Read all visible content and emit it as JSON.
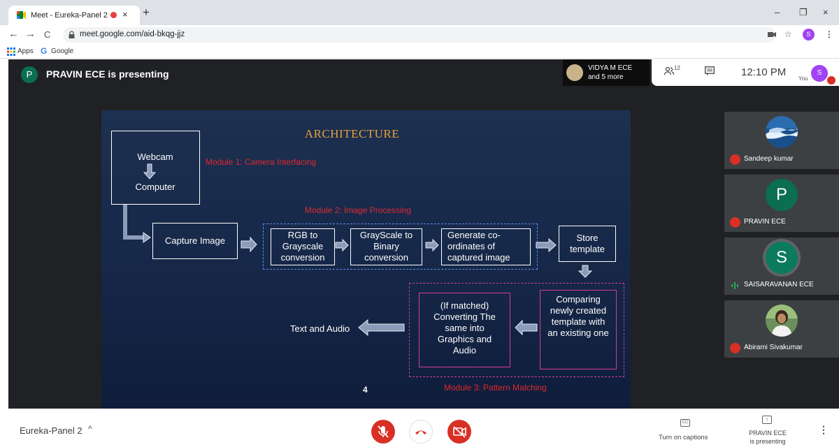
{
  "browser": {
    "tab_title": "Meet - Eureka-Panel 2",
    "tab_close": "×",
    "new_tab": "+",
    "url": "meet.google.com/aid-bkqg-jjz",
    "window_controls": [
      "–",
      "❐",
      "×"
    ],
    "nav": [
      "←",
      "→",
      "C"
    ],
    "bookmarks": [
      {
        "icon": "apps-grid-icon",
        "label": "Apps"
      },
      {
        "icon": "google-g-icon",
        "glyph": "G",
        "label": "Google"
      }
    ],
    "profile_initial": "S"
  },
  "meet": {
    "presenter_initial": "P",
    "presenter_text": "PRAVIN ECE is presenting",
    "viewers": {
      "line1": "VIDYA M ECE",
      "line2": "and 5 more"
    },
    "participants_count": "12",
    "time": "12:10 PM",
    "you_label": "You",
    "you_initial": "S",
    "participants": [
      {
        "name": "Sandeep kumar",
        "muted": true,
        "avatar": "photo-waves"
      },
      {
        "name": "PRAVIN ECE",
        "muted": true,
        "initial": "P",
        "color": "#0b6e4f"
      },
      {
        "name": "SAISARAVANAN ECE",
        "muted": false,
        "speaking": true,
        "initial": "S",
        "color": "#0b7b5e"
      },
      {
        "name": "Abirami Sivakumar",
        "muted": true,
        "avatar": "photo-person"
      }
    ]
  },
  "slide": {
    "title": "ARCHITECTURE",
    "webcam": "Webcam",
    "computer": "Computer",
    "module1": "Module 1: Camera Interfacing",
    "module2": "Module 2: Image Processing",
    "module3": "Module 3: Pattern Matching",
    "capture": "Capture Image",
    "rgb": "RGB to Grayscale conversion",
    "gray": "GrayScale to Binary conversion",
    "generate": "Generate co-ordinates of captured image",
    "store": "Store template",
    "comparing": "Comparing newly created template with an existing one",
    "converting": "(If matched) Converting The same into Graphics and Audio",
    "output": "Text and Audio",
    "page": "4",
    "colors": {
      "title": "#e8a33a",
      "module_label": "#e0272e",
      "module2_dash": "#5b8ee6",
      "module3_dash": "#d63ca0"
    }
  },
  "bottom": {
    "meeting_name": "Eureka-Panel 2",
    "captions_label": "Turn on captions",
    "captions_icon_text": "CC",
    "present_line1": "PRAVIN ECE",
    "present_line2": "is presenting",
    "present_icon_text": "↑",
    "more": "⋮",
    "chevron": "^"
  }
}
